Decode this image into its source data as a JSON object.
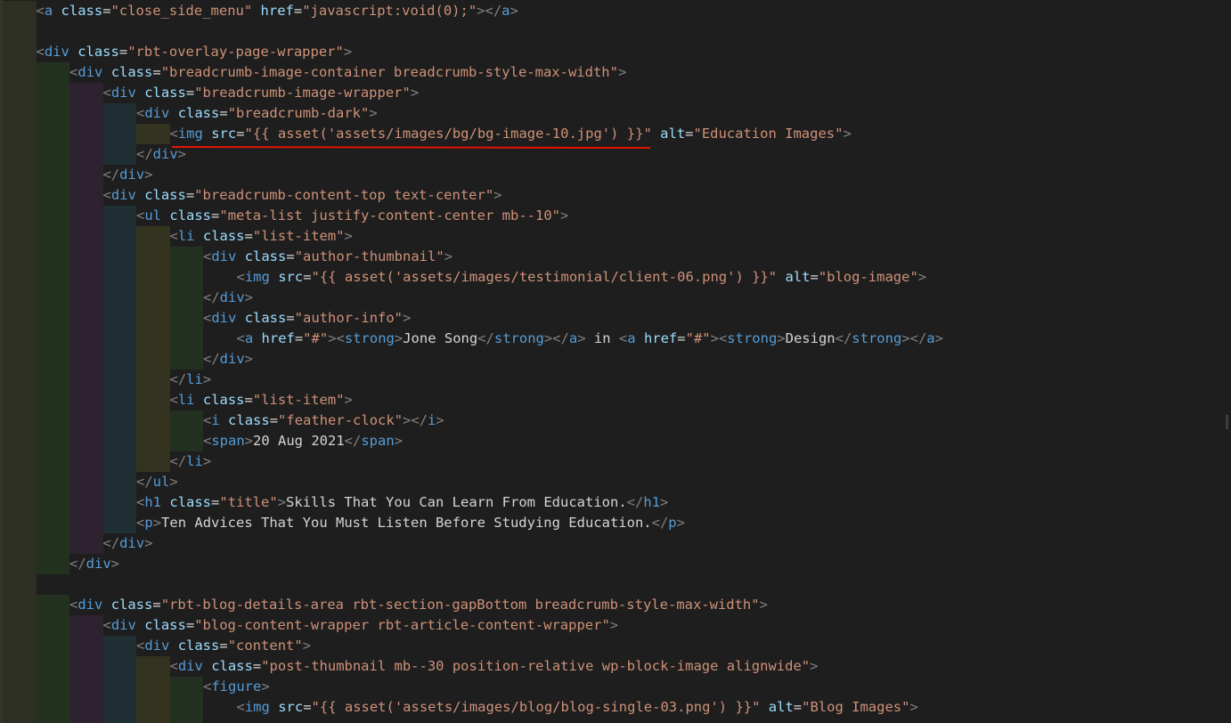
{
  "editor": {
    "language": "html",
    "annotation_color": "#e51400",
    "indent_colors": [
      "#2c2f22",
      "#23321f",
      "#2f2230",
      "#1f2f33",
      "#33331f",
      "#22301f"
    ],
    "token_colors": {
      "punctuation": "#808080",
      "tag": "#569cd6",
      "attribute": "#9cdcfe",
      "string": "#ce9178",
      "text": "#d4d4d4"
    },
    "lines": [
      {
        "indent": 1,
        "tokens": [
          [
            "p",
            "<"
          ],
          [
            "t",
            "a"
          ],
          [
            "x",
            " "
          ],
          [
            "a",
            "class"
          ],
          [
            "x",
            "="
          ],
          [
            "s",
            "\"close_side_menu\""
          ],
          [
            "x",
            " "
          ],
          [
            "a",
            "href"
          ],
          [
            "x",
            "="
          ],
          [
            "s",
            "\"javascript:void(0);\""
          ],
          [
            "p",
            "></"
          ],
          [
            "t",
            "a"
          ],
          [
            "p",
            ">"
          ]
        ]
      },
      {
        "indent": 1,
        "tokens": []
      },
      {
        "indent": 1,
        "tokens": [
          [
            "p",
            "<"
          ],
          [
            "t",
            "div"
          ],
          [
            "x",
            " "
          ],
          [
            "a",
            "class"
          ],
          [
            "x",
            "="
          ],
          [
            "s",
            "\"rbt-overlay-page-wrapper\""
          ],
          [
            "p",
            ">"
          ]
        ]
      },
      {
        "indent": 2,
        "tokens": [
          [
            "p",
            "<"
          ],
          [
            "t",
            "div"
          ],
          [
            "x",
            " "
          ],
          [
            "a",
            "class"
          ],
          [
            "x",
            "="
          ],
          [
            "s",
            "\"breadcrumb-image-container breadcrumb-style-max-width\""
          ],
          [
            "p",
            ">"
          ]
        ]
      },
      {
        "indent": 3,
        "tokens": [
          [
            "p",
            "<"
          ],
          [
            "t",
            "div"
          ],
          [
            "x",
            " "
          ],
          [
            "a",
            "class"
          ],
          [
            "x",
            "="
          ],
          [
            "s",
            "\"breadcrumb-image-wrapper\""
          ],
          [
            "p",
            ">"
          ]
        ]
      },
      {
        "indent": 4,
        "tokens": [
          [
            "p",
            "<"
          ],
          [
            "t",
            "div"
          ],
          [
            "x",
            " "
          ],
          [
            "a",
            "class"
          ],
          [
            "x",
            "="
          ],
          [
            "s",
            "\"breadcrumb-dark\""
          ],
          [
            "p",
            ">"
          ]
        ]
      },
      {
        "indent": 5,
        "tokens": [
          [
            "p",
            "<"
          ],
          [
            "t",
            "img"
          ],
          [
            "x",
            " "
          ],
          [
            "a",
            "src"
          ],
          [
            "x",
            "="
          ],
          [
            "s",
            "\"{{ asset('assets/images/bg/bg-image-10.jpg') }}\""
          ],
          [
            "x",
            " "
          ],
          [
            "a",
            "alt"
          ],
          [
            "x",
            "="
          ],
          [
            "s",
            "\"Education Images\""
          ],
          [
            "p",
            ">"
          ]
        ]
      },
      {
        "indent": 4,
        "tokens": [
          [
            "p",
            "</"
          ],
          [
            "t",
            "div"
          ],
          [
            "p",
            ">"
          ]
        ]
      },
      {
        "indent": 3,
        "tokens": [
          [
            "p",
            "</"
          ],
          [
            "t",
            "div"
          ],
          [
            "p",
            ">"
          ]
        ]
      },
      {
        "indent": 3,
        "tokens": [
          [
            "p",
            "<"
          ],
          [
            "t",
            "div"
          ],
          [
            "x",
            " "
          ],
          [
            "a",
            "class"
          ],
          [
            "x",
            "="
          ],
          [
            "s",
            "\"breadcrumb-content-top text-center\""
          ],
          [
            "p",
            ">"
          ]
        ]
      },
      {
        "indent": 4,
        "tokens": [
          [
            "p",
            "<"
          ],
          [
            "t",
            "ul"
          ],
          [
            "x",
            " "
          ],
          [
            "a",
            "class"
          ],
          [
            "x",
            "="
          ],
          [
            "s",
            "\"meta-list justify-content-center mb--10\""
          ],
          [
            "p",
            ">"
          ]
        ]
      },
      {
        "indent": 5,
        "tokens": [
          [
            "p",
            "<"
          ],
          [
            "t",
            "li"
          ],
          [
            "x",
            " "
          ],
          [
            "a",
            "class"
          ],
          [
            "x",
            "="
          ],
          [
            "s",
            "\"list-item\""
          ],
          [
            "p",
            ">"
          ]
        ]
      },
      {
        "indent": 6,
        "tokens": [
          [
            "p",
            "<"
          ],
          [
            "t",
            "div"
          ],
          [
            "x",
            " "
          ],
          [
            "a",
            "class"
          ],
          [
            "x",
            "="
          ],
          [
            "s",
            "\"author-thumbnail\""
          ],
          [
            "p",
            ">"
          ]
        ]
      },
      {
        "indent": 7,
        "tokens": [
          [
            "p",
            "<"
          ],
          [
            "t",
            "img"
          ],
          [
            "x",
            " "
          ],
          [
            "a",
            "src"
          ],
          [
            "x",
            "="
          ],
          [
            "s",
            "\"{{ asset('assets/images/testimonial/client-06.png') }}\""
          ],
          [
            "x",
            " "
          ],
          [
            "a",
            "alt"
          ],
          [
            "x",
            "="
          ],
          [
            "s",
            "\"blog-image\""
          ],
          [
            "p",
            ">"
          ]
        ]
      },
      {
        "indent": 6,
        "tokens": [
          [
            "p",
            "</"
          ],
          [
            "t",
            "div"
          ],
          [
            "p",
            ">"
          ]
        ]
      },
      {
        "indent": 6,
        "tokens": [
          [
            "p",
            "<"
          ],
          [
            "t",
            "div"
          ],
          [
            "x",
            " "
          ],
          [
            "a",
            "class"
          ],
          [
            "x",
            "="
          ],
          [
            "s",
            "\"author-info\""
          ],
          [
            "p",
            ">"
          ]
        ]
      },
      {
        "indent": 7,
        "tokens": [
          [
            "p",
            "<"
          ],
          [
            "t",
            "a"
          ],
          [
            "x",
            " "
          ],
          [
            "a",
            "href"
          ],
          [
            "x",
            "="
          ],
          [
            "s",
            "\"#\""
          ],
          [
            "p",
            "><"
          ],
          [
            "t",
            "strong"
          ],
          [
            "p",
            ">"
          ],
          [
            "x",
            "Jone Song"
          ],
          [
            "p",
            "</"
          ],
          [
            "t",
            "strong"
          ],
          [
            "p",
            "></"
          ],
          [
            "t",
            "a"
          ],
          [
            "p",
            ">"
          ],
          [
            "x",
            " in "
          ],
          [
            "p",
            "<"
          ],
          [
            "t",
            "a"
          ],
          [
            "x",
            " "
          ],
          [
            "a",
            "href"
          ],
          [
            "x",
            "="
          ],
          [
            "s",
            "\"#\""
          ],
          [
            "p",
            "><"
          ],
          [
            "t",
            "strong"
          ],
          [
            "p",
            ">"
          ],
          [
            "x",
            "Design"
          ],
          [
            "p",
            "</"
          ],
          [
            "t",
            "strong"
          ],
          [
            "p",
            "></"
          ],
          [
            "t",
            "a"
          ],
          [
            "p",
            ">"
          ]
        ]
      },
      {
        "indent": 6,
        "tokens": [
          [
            "p",
            "</"
          ],
          [
            "t",
            "div"
          ],
          [
            "p",
            ">"
          ]
        ]
      },
      {
        "indent": 5,
        "tokens": [
          [
            "p",
            "</"
          ],
          [
            "t",
            "li"
          ],
          [
            "p",
            ">"
          ]
        ]
      },
      {
        "indent": 5,
        "tokens": [
          [
            "p",
            "<"
          ],
          [
            "t",
            "li"
          ],
          [
            "x",
            " "
          ],
          [
            "a",
            "class"
          ],
          [
            "x",
            "="
          ],
          [
            "s",
            "\"list-item\""
          ],
          [
            "p",
            ">"
          ]
        ]
      },
      {
        "indent": 6,
        "tokens": [
          [
            "p",
            "<"
          ],
          [
            "t",
            "i"
          ],
          [
            "x",
            " "
          ],
          [
            "a",
            "class"
          ],
          [
            "x",
            "="
          ],
          [
            "s",
            "\"feather-clock\""
          ],
          [
            "p",
            "></"
          ],
          [
            "t",
            "i"
          ],
          [
            "p",
            ">"
          ]
        ]
      },
      {
        "indent": 6,
        "tokens": [
          [
            "p",
            "<"
          ],
          [
            "t",
            "span"
          ],
          [
            "p",
            ">"
          ],
          [
            "x",
            "20 Aug 2021"
          ],
          [
            "p",
            "</"
          ],
          [
            "t",
            "span"
          ],
          [
            "p",
            ">"
          ]
        ]
      },
      {
        "indent": 5,
        "tokens": [
          [
            "p",
            "</"
          ],
          [
            "t",
            "li"
          ],
          [
            "p",
            ">"
          ]
        ]
      },
      {
        "indent": 4,
        "tokens": [
          [
            "p",
            "</"
          ],
          [
            "t",
            "ul"
          ],
          [
            "p",
            ">"
          ]
        ]
      },
      {
        "indent": 4,
        "tokens": [
          [
            "p",
            "<"
          ],
          [
            "t",
            "h1"
          ],
          [
            "x",
            " "
          ],
          [
            "a",
            "class"
          ],
          [
            "x",
            "="
          ],
          [
            "s",
            "\"title\""
          ],
          [
            "p",
            ">"
          ],
          [
            "x",
            "Skills That You Can Learn From Education."
          ],
          [
            "p",
            "</"
          ],
          [
            "t",
            "h1"
          ],
          [
            "p",
            ">"
          ]
        ]
      },
      {
        "indent": 4,
        "tokens": [
          [
            "p",
            "<"
          ],
          [
            "t",
            "p"
          ],
          [
            "p",
            ">"
          ],
          [
            "x",
            "Ten Advices That You Must Listen Before Studying Education."
          ],
          [
            "p",
            "</"
          ],
          [
            "t",
            "p"
          ],
          [
            "p",
            ">"
          ]
        ]
      },
      {
        "indent": 3,
        "tokens": [
          [
            "p",
            "</"
          ],
          [
            "t",
            "div"
          ],
          [
            "p",
            ">"
          ]
        ]
      },
      {
        "indent": 2,
        "tokens": [
          [
            "p",
            "</"
          ],
          [
            "t",
            "div"
          ],
          [
            "p",
            ">"
          ]
        ]
      },
      {
        "indent": 1,
        "tokens": []
      },
      {
        "indent": 2,
        "tokens": [
          [
            "p",
            "<"
          ],
          [
            "t",
            "div"
          ],
          [
            "x",
            " "
          ],
          [
            "a",
            "class"
          ],
          [
            "x",
            "="
          ],
          [
            "s",
            "\"rbt-blog-details-area rbt-section-gapBottom breadcrumb-style-max-width\""
          ],
          [
            "p",
            ">"
          ]
        ]
      },
      {
        "indent": 3,
        "tokens": [
          [
            "p",
            "<"
          ],
          [
            "t",
            "div"
          ],
          [
            "x",
            " "
          ],
          [
            "a",
            "class"
          ],
          [
            "x",
            "="
          ],
          [
            "s",
            "\"blog-content-wrapper rbt-article-content-wrapper\""
          ],
          [
            "p",
            ">"
          ]
        ]
      },
      {
        "indent": 4,
        "tokens": [
          [
            "p",
            "<"
          ],
          [
            "t",
            "div"
          ],
          [
            "x",
            " "
          ],
          [
            "a",
            "class"
          ],
          [
            "x",
            "="
          ],
          [
            "s",
            "\"content\""
          ],
          [
            "p",
            ">"
          ]
        ]
      },
      {
        "indent": 5,
        "tokens": [
          [
            "p",
            "<"
          ],
          [
            "t",
            "div"
          ],
          [
            "x",
            " "
          ],
          [
            "a",
            "class"
          ],
          [
            "x",
            "="
          ],
          [
            "s",
            "\"post-thumbnail mb--30 position-relative wp-block-image alignwide\""
          ],
          [
            "p",
            ">"
          ]
        ]
      },
      {
        "indent": 6,
        "tokens": [
          [
            "p",
            "<"
          ],
          [
            "t",
            "figure"
          ],
          [
            "p",
            ">"
          ]
        ]
      },
      {
        "indent": 7,
        "tokens": [
          [
            "p",
            "<"
          ],
          [
            "t",
            "img"
          ],
          [
            "x",
            " "
          ],
          [
            "a",
            "src"
          ],
          [
            "x",
            "="
          ],
          [
            "s",
            "\"{{ asset('assets/images/blog/blog-single-03.png') }}\""
          ],
          [
            "x",
            " "
          ],
          [
            "a",
            "alt"
          ],
          [
            "x",
            "="
          ],
          [
            "s",
            "\"Blog Images\""
          ],
          [
            "p",
            ">"
          ]
        ]
      },
      {
        "indent": 7,
        "tokens": []
      }
    ]
  }
}
